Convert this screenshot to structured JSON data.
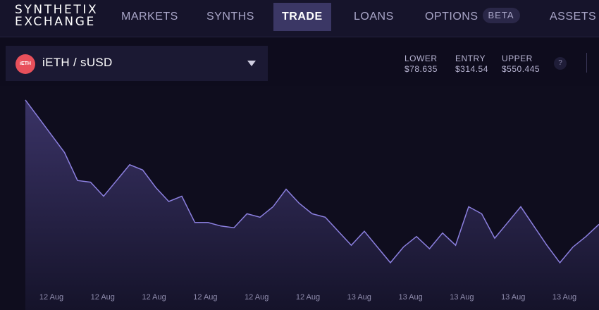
{
  "logo": {
    "line1": "SYNTHETIX",
    "line2": "EXCHANGE"
  },
  "nav": [
    {
      "label": "MARKETS"
    },
    {
      "label": "SYNTHS"
    },
    {
      "label": "TRADE",
      "active": true
    },
    {
      "label": "LOANS"
    },
    {
      "label": "OPTIONS",
      "badge": "BETA"
    },
    {
      "label": "ASSETS"
    }
  ],
  "pair": {
    "icon_text": "iETH",
    "label": "iETH / sUSD"
  },
  "stats": {
    "lower_label": "LOWER",
    "lower_value": "$78.635",
    "entry_label": "ENTRY",
    "entry_value": "$314.54",
    "upper_label": "UPPER",
    "upper_value": "$550.445",
    "help": "?"
  },
  "colors": {
    "line": "#8c80e0",
    "fill_top": "#3a3366",
    "fill_bottom": "#15132a",
    "active_tab": "#3b3765",
    "badge_red": "#e8505b"
  },
  "chart_data": {
    "type": "area",
    "x_labels": [
      "12 Aug",
      "12 Aug",
      "12 Aug",
      "12 Aug",
      "12 Aug",
      "12 Aug",
      "13 Aug",
      "13 Aug",
      "13 Aug",
      "13 Aug",
      "13 Aug"
    ],
    "values": [
      100,
      95,
      90,
      85,
      77,
      76.5,
      72.5,
      77,
      81.5,
      80,
      75,
      71,
      72.5,
      65,
      65,
      64,
      63.5,
      67.5,
      66.5,
      69.5,
      74.5,
      70.5,
      67.5,
      66.5,
      62.5,
      58.5,
      62.5,
      58,
      53.5,
      58,
      61,
      57.5,
      62,
      58.5,
      69.5,
      67.5,
      60.5,
      65,
      69.5,
      64,
      58.5,
      53.5,
      58,
      61,
      64.5
    ],
    "ylim": [
      40,
      104
    ],
    "grid": false
  }
}
